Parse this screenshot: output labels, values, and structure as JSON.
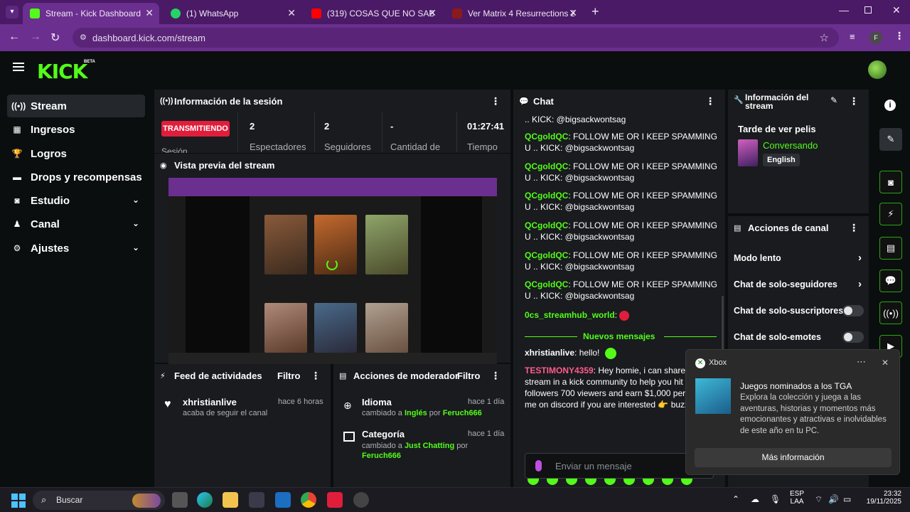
{
  "browser": {
    "tabs": [
      {
        "title": "Stream - Kick Dashboard",
        "active": true,
        "favicon_color": "#53fc18"
      },
      {
        "title": "(1) WhatsApp",
        "active": false,
        "favicon_color": "#25d366"
      },
      {
        "title": "(319) COSAS QUE NO SABIAS D",
        "active": false,
        "favicon_color": "#ff0000"
      },
      {
        "title": "Ver Matrix 4 Resurrections 2021",
        "active": false,
        "favicon_color": "#8b1a1a"
      }
    ],
    "url": "dashboard.kick.com/stream",
    "profile_initial": "F"
  },
  "app": {
    "logo": "KICK",
    "beta": "BETA",
    "sidebar": [
      {
        "label": "Stream",
        "icon": "broadcast-icon",
        "active": true,
        "expandable": false
      },
      {
        "label": "Ingresos",
        "icon": "chart-icon",
        "active": false,
        "expandable": false
      },
      {
        "label": "Logros",
        "icon": "trophy-icon",
        "active": false,
        "expandable": false
      },
      {
        "label": "Drops y recompensas",
        "icon": "gift-icon",
        "active": false,
        "expandable": false
      },
      {
        "label": "Estudio",
        "icon": "camera-icon",
        "active": false,
        "expandable": true
      },
      {
        "label": "Canal",
        "icon": "user-icon",
        "active": false,
        "expandable": true
      },
      {
        "label": "Ajustes",
        "icon": "gear-icon",
        "active": false,
        "expandable": true
      }
    ],
    "session": {
      "title": "Información de la sesión",
      "status": "TRANSMITIENDO",
      "status_sub": "Sesión",
      "stats": [
        {
          "value": "2",
          "label": "Espectadores"
        },
        {
          "value": "2",
          "label": "Seguidores"
        },
        {
          "value": "-",
          "label": "Cantidad de"
        },
        {
          "value": "01:27:41",
          "label": "Tiempo"
        }
      ]
    },
    "preview": {
      "title": "Vista previa del stream"
    },
    "feed": {
      "title": "Feed de actividades",
      "filter": "Filtro",
      "items": [
        {
          "name": "xhristianlive",
          "sub": "acaba de seguir el canal",
          "time": "hace 6 horas"
        }
      ]
    },
    "moderator": {
      "title": "Acciones de moderador",
      "filter": "Filtro",
      "items": [
        {
          "title": "Idioma",
          "sub_pre": "cambiado a",
          "value": "Inglés",
          "by": "por",
          "user": "Feruch666",
          "time": "hace 1 día"
        },
        {
          "title": "Categoría",
          "sub_pre": "cambiado a",
          "value": "Just Chatting",
          "by": "por",
          "user": "Feruch666",
          "time": "hace 1 día"
        }
      ]
    },
    "chat": {
      "title": "Chat",
      "messages": [
        {
          "user": "",
          "text": ".. KICK: @bigsackwontsag"
        },
        {
          "user": "QCgoldQC",
          "text": "FOLLOW ME OR I KEEP SPAMMING U .. KICK: @bigsackwontsag"
        },
        {
          "user": "QCgoldQC",
          "text": "FOLLOW ME OR I KEEP SPAMMING U .. KICK: @bigsackwontsag"
        },
        {
          "user": "QCgoldQC",
          "text": "FOLLOW ME OR I KEEP SPAMMING U .. KICK: @bigsackwontsag"
        },
        {
          "user": "QCgoldQC",
          "text": "FOLLOW ME OR I KEEP SPAMMING U .. KICK: @bigsackwontsag"
        },
        {
          "user": "QCgoldQC",
          "text": "FOLLOW ME OR I KEEP SPAMMING U .. KICK: @bigsackwontsag"
        },
        {
          "user": "QCgoldQC",
          "text": "FOLLOW ME OR I KEEP SPAMMING U .. KICK: @bigsackwontsag"
        }
      ],
      "streamhub_user": "0cs_streamhub_world",
      "new_messages": "Nuevos mensajes",
      "hello_user": "xhristianlive",
      "hello_text": "hello!",
      "spam_user": "TESTIMONY4359",
      "spam_text": "Hey homie, i can share y stream in a kick community to help you hit 1! followers 700 viewers and earn $1,000 per s add me on discord if you are interested 👉 buzzup54",
      "input_placeholder": "Enviar un mensaje",
      "user_color_green": "#53fc18",
      "user_color_pink": "#ff5c8a"
    },
    "stream_info": {
      "title": "Información del stream",
      "stream_title": "Tarde de ver pelis",
      "category": "Conversando",
      "language": "English"
    },
    "channel_actions": {
      "title": "Acciones de canal",
      "items": [
        {
          "label": "Modo lento",
          "type": "chevron"
        },
        {
          "label": "Chat de solo-seguidores",
          "type": "chevron"
        },
        {
          "label": "Chat de solo-suscriptores",
          "type": "toggle",
          "on": false
        },
        {
          "label": "Chat de solo-emotes",
          "type": "toggle",
          "on": false
        }
      ]
    }
  },
  "toast": {
    "app": "Xbox",
    "title": "Juegos nominados a los TGA",
    "body": "Explora la colección y juega a las aventuras, historias y momentos más emocionantes y atractivas e inolvidables de este año en tu PC.",
    "button": "Más información"
  },
  "taskbar": {
    "search": "Buscar",
    "lang": "ESP",
    "lang2": "LAA",
    "time": "23:32",
    "date": "19/11/2025"
  },
  "accent": "#53fc18"
}
